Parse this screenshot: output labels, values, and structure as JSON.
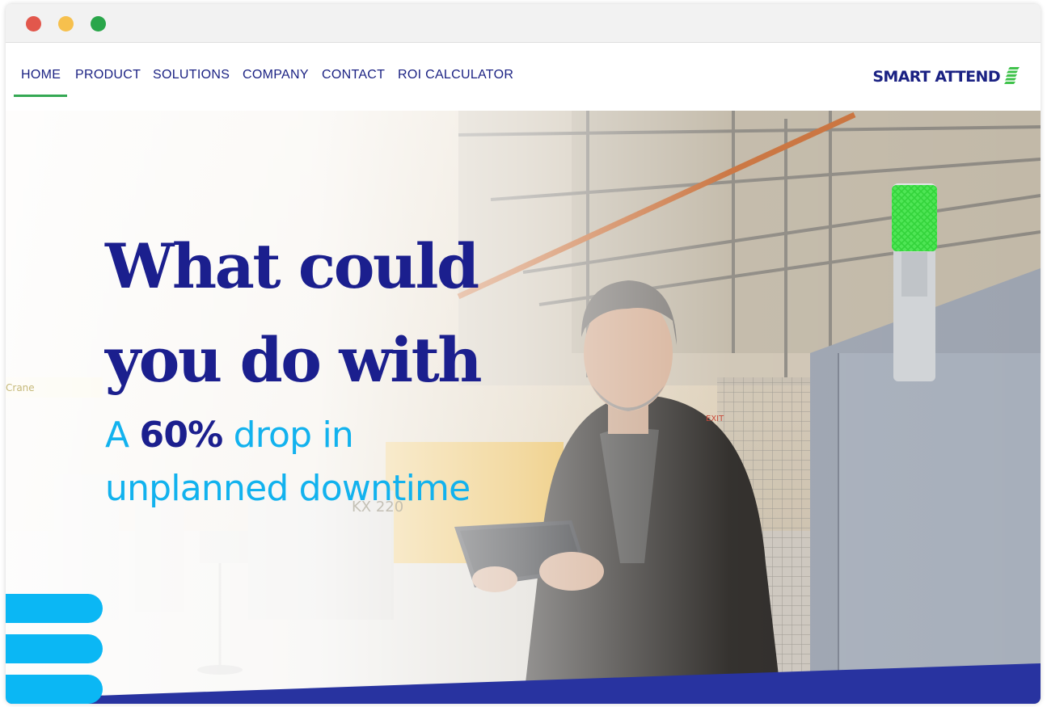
{
  "window": {
    "controls": [
      "close",
      "minimize",
      "maximize"
    ]
  },
  "nav": {
    "items": [
      {
        "label": "HOME",
        "active": true
      },
      {
        "label": "PRODUCT"
      },
      {
        "label": "SOLUTIONS"
      },
      {
        "label": "COMPANY"
      },
      {
        "label": "CONTACT"
      },
      {
        "label": "ROI CALCULATOR"
      }
    ]
  },
  "logo": {
    "text": "SMART ATTEND"
  },
  "hero": {
    "headline_line1": "What could",
    "headline_line2": "you do with",
    "subline_prefix": "A ",
    "subline_highlight": "60%",
    "subline_suffix": " drop in",
    "subline_line2": "unplanned downtime",
    "background_labels": [
      "KX 220",
      "EXIT",
      "Crane"
    ]
  },
  "colors": {
    "brand_navy": "#1b1f8e",
    "accent_cyan": "#12b2ee",
    "active_underline": "#34a853",
    "stack_light_green": "#4be552"
  }
}
